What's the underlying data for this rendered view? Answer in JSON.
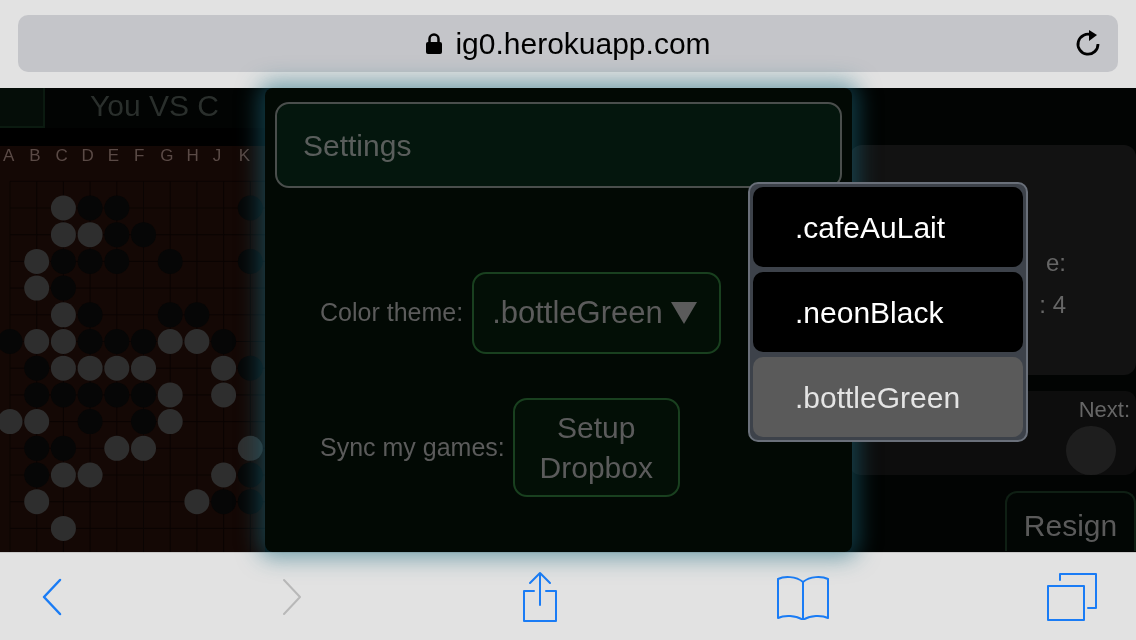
{
  "address_bar": {
    "url": "ig0.herokuapp.com"
  },
  "game": {
    "title": "You VS C",
    "board": {
      "column_labels": [
        "A",
        "B",
        "C",
        "D",
        "E",
        "F",
        "G",
        "H",
        "J",
        "K"
      ]
    },
    "side_panel": {
      "score_fragments": [
        "e:",
        ": 4"
      ],
      "next_label": "Next:",
      "resign_button": "Resign"
    }
  },
  "settings_dialog": {
    "title": "Settings",
    "rows": [
      {
        "kind": "select",
        "label": "Color theme:",
        "value": ".bottleGreen"
      },
      {
        "kind": "button",
        "label": "Sync my games:",
        "button": "Setup Dropbox"
      }
    ]
  },
  "theme_dropdown": {
    "options": [
      {
        "label": ".cafeAuLait",
        "selected": false
      },
      {
        "label": ".neonBlack",
        "selected": false
      },
      {
        "label": ".bottleGreen",
        "selected": true
      }
    ]
  },
  "toolbar": {
    "buttons": [
      {
        "kind": "back",
        "disabled": false
      },
      {
        "kind": "forward",
        "disabled": true
      },
      {
        "kind": "share"
      },
      {
        "kind": "bookmarks"
      },
      {
        "kind": "tabs"
      }
    ]
  }
}
